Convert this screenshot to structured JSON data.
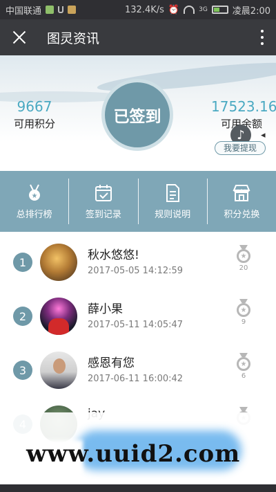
{
  "statusbar": {
    "carrier": "中国联通",
    "speed": "132.4K/s",
    "network_badge": "3G",
    "time": "凌晨2:00"
  },
  "titlebar": {
    "title": "图灵资讯",
    "close_icon": "close-icon",
    "more_icon": "more-vertical-icon"
  },
  "hero": {
    "checkin_label": "已签到",
    "points_value": "9667",
    "points_label": "可用积分",
    "balance_value": "17523.16",
    "balance_label": "可用余额",
    "withdraw_label": "我要提现",
    "music_icon": "music-icon"
  },
  "nav": [
    {
      "label": "总排行榜",
      "icon": "medal-icon"
    },
    {
      "label": "签到记录",
      "icon": "calendar-check-icon"
    },
    {
      "label": "规则说明",
      "icon": "document-icon"
    },
    {
      "label": "积分兑换",
      "icon": "shop-icon"
    }
  ],
  "list": [
    {
      "rank": "1",
      "name": "秋水悠悠!",
      "time": "2017-05-05 14:12:59",
      "count": "20"
    },
    {
      "rank": "2",
      "name": "薛小果",
      "time": "2017-05-11 14:05:47",
      "count": "9"
    },
    {
      "rank": "3",
      "name": "感恩有您",
      "time": "2017-06-11 16:00:42",
      "count": "6"
    },
    {
      "rank": "4",
      "name": "jay",
      "time": "",
      "count": ""
    }
  ],
  "watermark": {
    "text": "www.uuid2.com"
  },
  "colors": {
    "accent": "#6f99a8",
    "nav_band": "#7fa7b7",
    "number_text": "#4aa9c2",
    "titlebar_bg": "#393a3e"
  }
}
